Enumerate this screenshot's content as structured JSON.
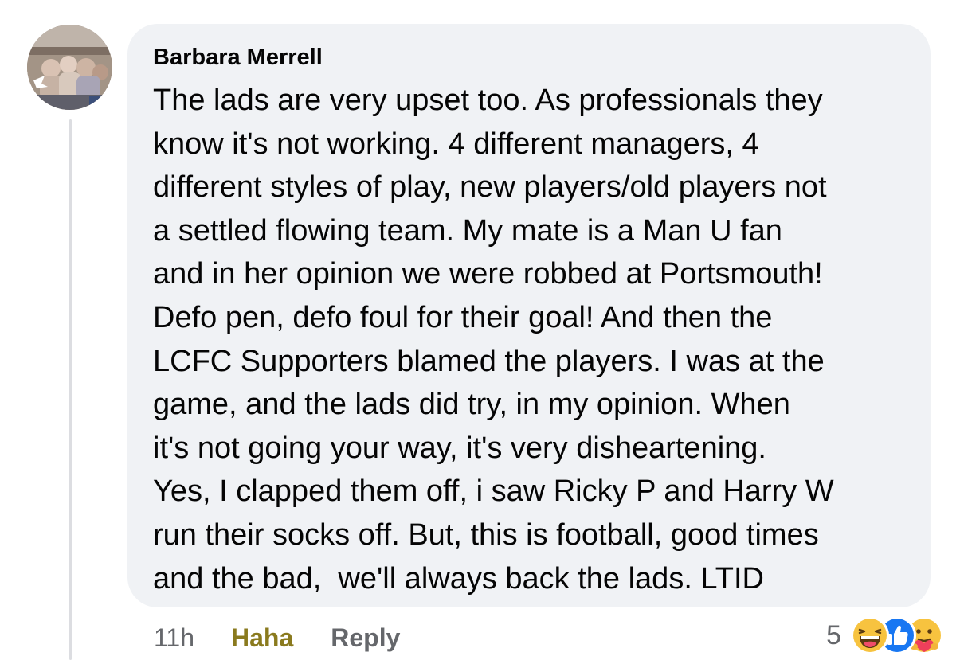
{
  "comment": {
    "author": "Barbara Merrell",
    "body_lines": [
      "The lads are very upset too. As professionals they",
      "know it's not working. 4 different managers, 4",
      "different styles of play, new players/old players not",
      "a settled flowing team. My mate is a Man U fan",
      "and in her opinion we were robbed at Portsmouth!",
      "Defo pen, defo foul for their goal! And then the",
      "LCFC Supporters blamed the players. I was at the",
      "game, and the lads did try, in my opinion. When",
      "it's not going your way, it's very disheartening.",
      "Yes, I clapped them off, i saw Ricky P and Harry W",
      "run their socks off. But, this is football, good times",
      "and the bad,  we'll always back the lads. LTID"
    ]
  },
  "actions": {
    "timestamp": "11h",
    "reaction_label": "Haha",
    "reply_label": "Reply"
  },
  "reactions": {
    "count": "5",
    "icons": [
      "haha-icon",
      "like-icon",
      "care-icon"
    ]
  },
  "colors": {
    "bubble_bg": "#f0f2f5",
    "text": "#050505",
    "secondary_text": "#65676b",
    "haha_active": "#8a7a1e",
    "like_blue": "#1877f2"
  }
}
